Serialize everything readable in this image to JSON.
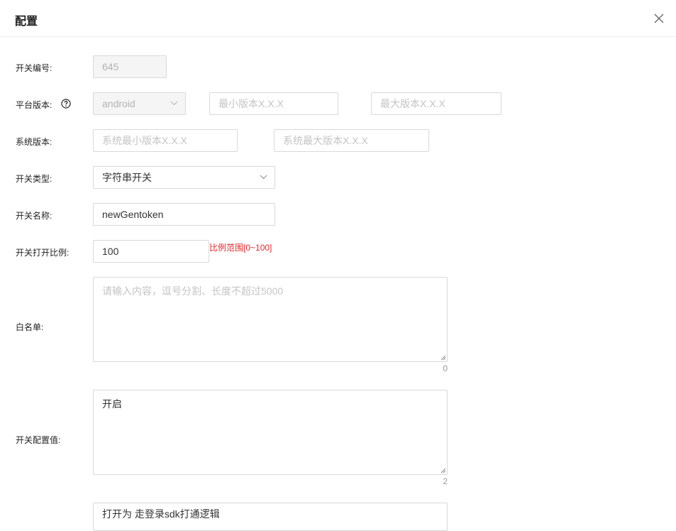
{
  "dialog": {
    "title": "配置"
  },
  "fields": {
    "switch_id": {
      "label": "开关编号:",
      "value": "645"
    },
    "platform": {
      "label": "平台版本:",
      "selected": "android",
      "min_placeholder": "最小版本X.X.X",
      "max_placeholder": "最大版本X.X.X"
    },
    "system": {
      "label": "系统版本:",
      "min_placeholder": "系统最小版本X.X.X",
      "max_placeholder": "系统最大版本X.X.X"
    },
    "switch_type": {
      "label": "开关类型:",
      "selected": "字符串开关"
    },
    "switch_name": {
      "label": "开关名称:",
      "value": "newGentoken"
    },
    "ratio": {
      "label": "开关打开比例:",
      "value": "100",
      "hint": "比例范围[0~100]"
    },
    "whitelist": {
      "label": "白名单:",
      "placeholder": "请输入内容，逗号分割、长度不超过5000",
      "count": "0"
    },
    "config_value": {
      "label": "开关配置值:",
      "value": "开启",
      "count": "2"
    },
    "description": {
      "value": "打开为 走登录sdk打通逻辑"
    }
  },
  "colors": {
    "error": "#e0282e",
    "border": "#d9d9d9",
    "disabled_bg": "#f5f5f5"
  }
}
